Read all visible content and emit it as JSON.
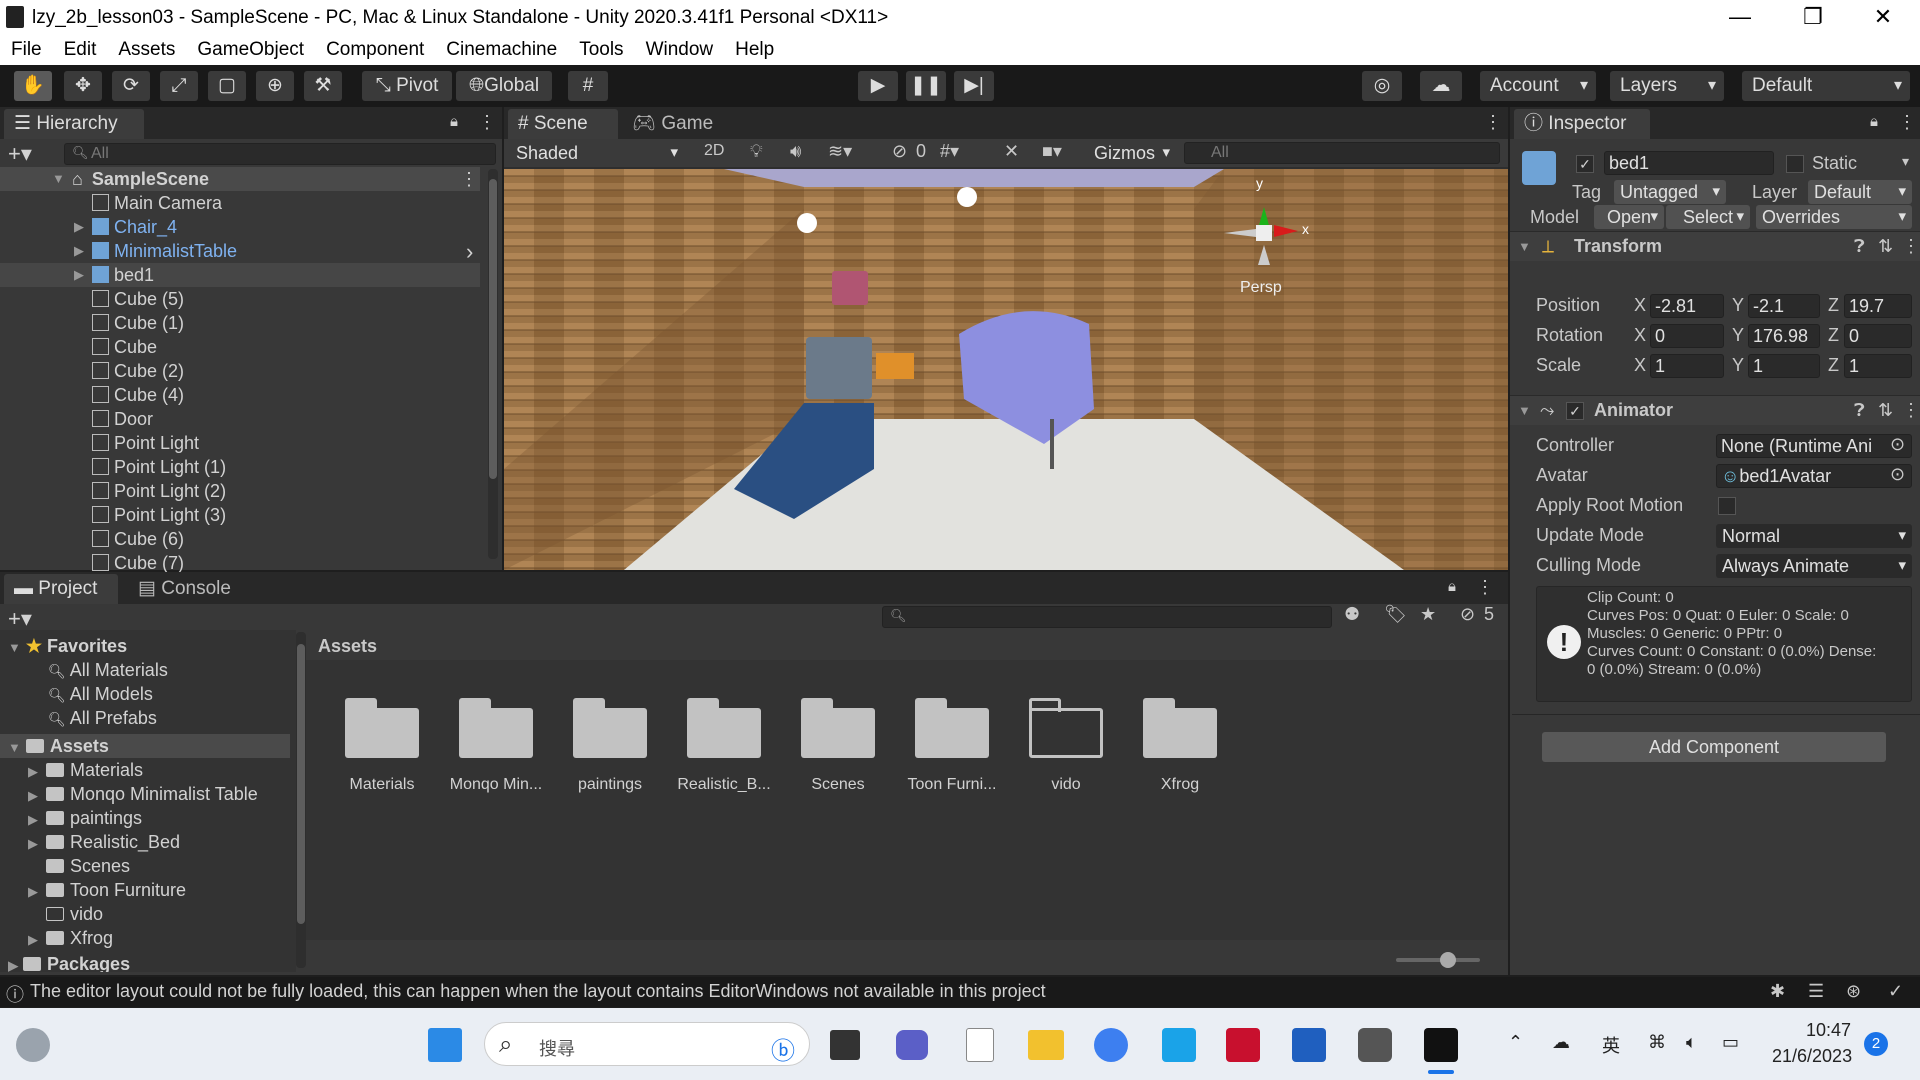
{
  "window": {
    "title": "lzy_2b_lesson03 - SampleScene - PC, Mac & Linux Standalone - Unity 2020.3.41f1 Personal <DX11>"
  },
  "menu": [
    "File",
    "Edit",
    "Assets",
    "GameObject",
    "Component",
    "Cinemachine",
    "Tools",
    "Window",
    "Help"
  ],
  "toolbar": {
    "pivot": "Pivot",
    "global": "Global",
    "account": "Account",
    "layers": "Layers",
    "layout": "Default"
  },
  "hierarchy": {
    "tab": "Hierarchy",
    "search_placeholder": "All",
    "scene": "SampleScene",
    "items": [
      {
        "label": "Main Camera",
        "prefab": false
      },
      {
        "label": "Chair_4",
        "prefab": true
      },
      {
        "label": "MinimalistTable",
        "prefab": true
      },
      {
        "label": "bed1",
        "prefab": true
      },
      {
        "label": "Cube (5)",
        "prefab": false
      },
      {
        "label": "Cube (1)",
        "prefab": false
      },
      {
        "label": "Cube",
        "prefab": false
      },
      {
        "label": "Cube (2)",
        "prefab": false
      },
      {
        "label": "Cube (4)",
        "prefab": false
      },
      {
        "label": "Door",
        "prefab": false
      },
      {
        "label": "Point Light",
        "prefab": false
      },
      {
        "label": "Point Light (1)",
        "prefab": false
      },
      {
        "label": "Point Light (2)",
        "prefab": false
      },
      {
        "label": "Point Light (3)",
        "prefab": false
      },
      {
        "label": "Cube (6)",
        "prefab": false
      },
      {
        "label": "Cube (7)",
        "prefab": false
      }
    ]
  },
  "scene": {
    "tab_scene": "Scene",
    "tab_game": "Game",
    "shading": "Shaded",
    "mode2d": "2D",
    "hidden_count": "0",
    "gizmos": "Gizmos",
    "search_placeholder": "All",
    "persp": "Persp",
    "axis_x": "x",
    "axis_y": "y"
  },
  "inspector": {
    "tab": "Inspector",
    "object_name": "bed1",
    "static": "Static",
    "tag_label": "Tag",
    "tag": "Untagged",
    "layer_label": "Layer",
    "layer": "Default",
    "model_label": "Model",
    "open": "Open",
    "select": "Select",
    "overrides": "Overrides",
    "transform": {
      "title": "Transform",
      "position_label": "Position",
      "rotation_label": "Rotation",
      "scale_label": "Scale",
      "position": {
        "x": "-2.81",
        "y": "-2.1",
        "z": "19.7"
      },
      "rotation": {
        "x": "0",
        "y": "176.98",
        "z": "0"
      },
      "scale": {
        "x": "1",
        "y": "1",
        "z": "1"
      }
    },
    "animator": {
      "title": "Animator",
      "controller_label": "Controller",
      "controller": "None (Runtime Ani",
      "avatar_label": "Avatar",
      "avatar": "bed1Avatar",
      "root_motion_label": "Apply Root Motion",
      "update_label": "Update Mode",
      "update": "Normal",
      "culling_label": "Culling Mode",
      "culling": "Always Animate",
      "info": [
        "Clip Count: 0",
        "Curves Pos: 0 Quat: 0 Euler: 0 Scale: 0",
        "Muscles: 0 Generic: 0 PPtr: 0",
        "Curves Count: 0 Constant: 0 (0.0%) Dense:",
        "0 (0.0%) Stream: 0 (0.0%)"
      ]
    },
    "add_component": "Add Component"
  },
  "project": {
    "tab_project": "Project",
    "tab_console": "Console",
    "hidden_count": "5",
    "favorites": "Favorites",
    "fav_items": [
      "All Materials",
      "All Models",
      "All Prefabs"
    ],
    "assets_root": "Assets",
    "tree": [
      "Materials",
      "Monqo Minimalist Table",
      "paintings",
      "Realistic_Bed",
      "Scenes",
      "Toon Furniture",
      "vido",
      "Xfrog"
    ],
    "packages": "Packages",
    "breadcrumb": "Assets",
    "grid": [
      "Materials",
      "Monqo Min...",
      "paintings",
      "Realistic_B...",
      "Scenes",
      "Toon Furni...",
      "vido",
      "Xfrog"
    ]
  },
  "status": {
    "message": "The editor layout could not be fully loaded, this can happen when the layout contains EditorWindows not available in this project"
  },
  "taskbar": {
    "search": "搜尋",
    "lang": "英",
    "time": "10:47",
    "date": "21/6/2023",
    "notif": "2"
  }
}
